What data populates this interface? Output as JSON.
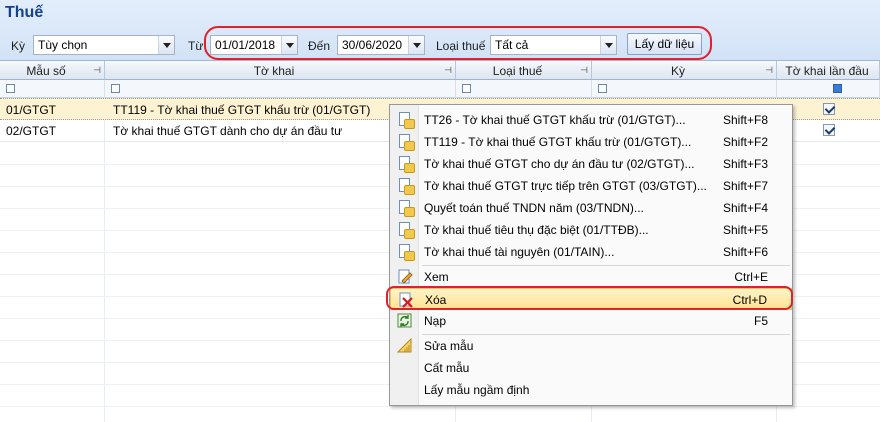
{
  "window": {
    "title": "Thuế"
  },
  "filters": {
    "ky_label": "Kỳ",
    "ky_value": "Tùy chọn",
    "tu_label": "Từ",
    "tu_value": "01/01/2018",
    "den_label": "Đến",
    "den_value": "30/06/2020",
    "loai_label": "Loại thuế",
    "loai_value": "Tất cả",
    "load_button": "Lấy dữ liệu"
  },
  "grid": {
    "columns": [
      "Mẫu số",
      "Tờ khai",
      "Loại thuế",
      "Kỳ",
      "Tờ khai lần đầu"
    ],
    "rows": [
      {
        "mau_so": "01/GTGT",
        "to_khai": "TT119 - Tờ khai thuế GTGT khấu trừ (01/GTGT)",
        "lan_dau": true,
        "selected": true
      },
      {
        "mau_so": "02/GTGT",
        "to_khai": "Tờ khai thuế GTGT dành cho dự án đầu tư",
        "lan_dau": true,
        "selected": false
      }
    ]
  },
  "context_menu": {
    "items": [
      {
        "label": "TT26 - Tờ khai thuế GTGT khấu trừ (01/GTGT)...",
        "shortcut": "Shift+F8",
        "icon": "document-icon"
      },
      {
        "label": "TT119 - Tờ khai thuế GTGT khấu trừ (01/GTGT)...",
        "shortcut": "Shift+F2",
        "icon": "document-icon"
      },
      {
        "label": "Tờ khai thuế GTGT cho dự án đầu tư (02/GTGT)...",
        "shortcut": "Shift+F3",
        "icon": "document-icon"
      },
      {
        "label": "Tờ khai thuế GTGT trực tiếp trên GTGT (03/GTGT)...",
        "shortcut": "Shift+F7",
        "icon": "document-icon"
      },
      {
        "label": "Quyết toán thuế TNDN năm (03/TNDN)...",
        "shortcut": "Shift+F4",
        "icon": "document-icon"
      },
      {
        "label": "Tờ khai thuế tiêu thụ đặc biệt (01/TTĐB)...",
        "shortcut": "Shift+F5",
        "icon": "document-icon"
      },
      {
        "label": "Tờ khai thuế tài nguyên (01/TAIN)...",
        "shortcut": "Shift+F6",
        "icon": "document-icon"
      },
      {
        "label": "Xem",
        "shortcut": "Ctrl+E",
        "icon": "edit-icon"
      },
      {
        "label": "Xóa",
        "shortcut": "Ctrl+D",
        "icon": "delete-icon"
      },
      {
        "label": "Nạp",
        "shortcut": "F5",
        "icon": "refresh-icon"
      },
      {
        "label": "Sửa mẫu",
        "shortcut": "",
        "icon": "ruler-icon"
      },
      {
        "label": "Cất mẫu",
        "shortcut": "",
        "icon": ""
      },
      {
        "label": "Lấy mẫu ngầm định",
        "shortcut": "",
        "icon": ""
      }
    ]
  },
  "colors": {
    "accent_title": "#15428b",
    "highlight_border": "#e0202a",
    "selected_row": "#fdf3d3",
    "menu_hover": "#ffe391"
  }
}
